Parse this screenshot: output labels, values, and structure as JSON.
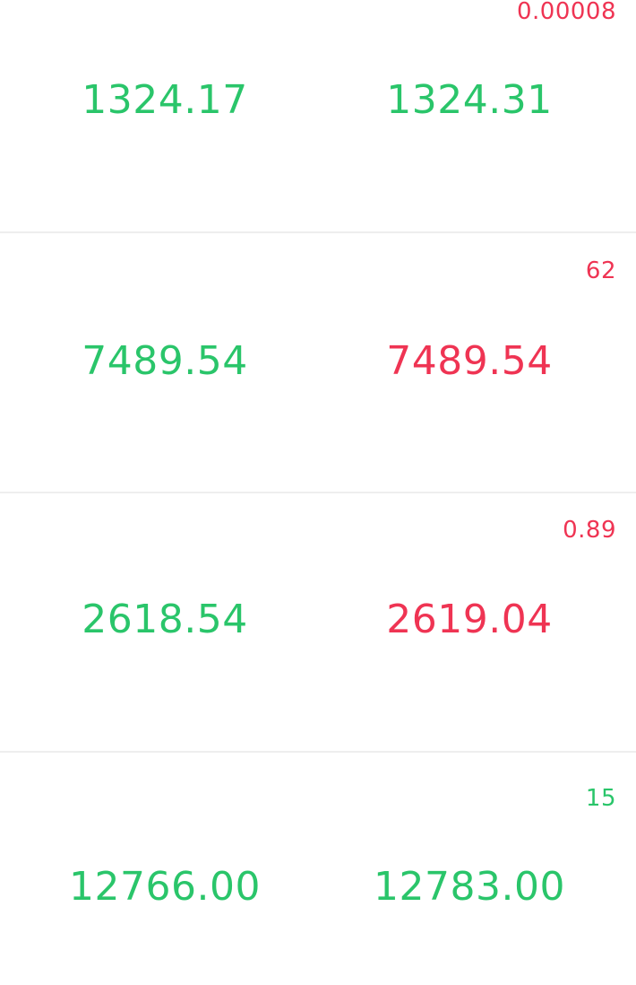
{
  "colors": {
    "up": "#2ac56a",
    "down": "#ef3453",
    "divider": "#eeeeee",
    "background": "#ffffff"
  },
  "rows": [
    {
      "spread": "0.00008",
      "spread_color": "down",
      "bid": "1324.17",
      "bid_color": "up",
      "ask": "1324.31",
      "ask_color": "up"
    },
    {
      "spread": "62",
      "spread_color": "down",
      "bid": "7489.54",
      "bid_color": "up",
      "ask": "7489.54",
      "ask_color": "down"
    },
    {
      "spread": "0.89",
      "spread_color": "down",
      "bid": "2618.54",
      "bid_color": "up",
      "ask": "2619.04",
      "ask_color": "down"
    },
    {
      "spread": "15",
      "spread_color": "up",
      "bid": "12766.00",
      "bid_color": "up",
      "ask": "12783.00",
      "ask_color": "up"
    }
  ]
}
